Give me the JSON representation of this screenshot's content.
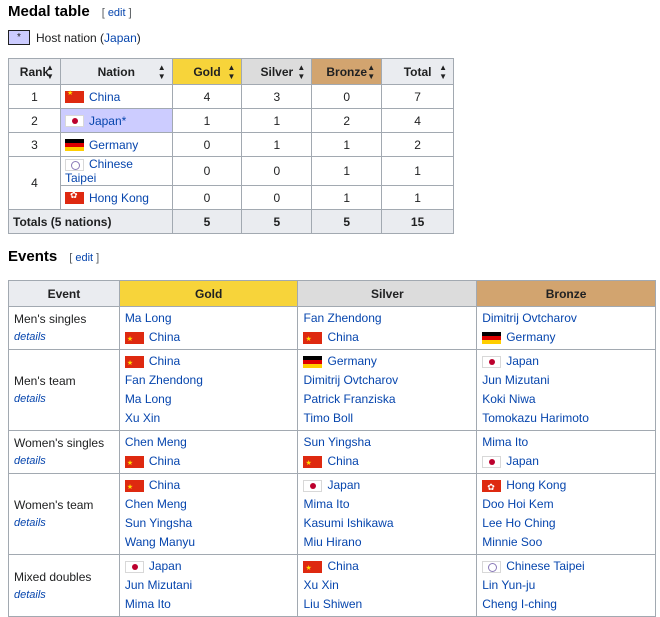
{
  "medal_section": {
    "title": "Medal table",
    "edit_label": "edit",
    "host_marker": "*",
    "host_note_prefix": "Host nation (",
    "host_note_link": "Japan",
    "host_note_suffix": ")"
  },
  "medal_table": {
    "headers": [
      "Rank",
      "Nation",
      "Gold",
      "Silver",
      "Bronze",
      "Total"
    ],
    "rows": [
      {
        "rank": "1",
        "flag": "china-flag-icon",
        "nation": "China",
        "gold": "4",
        "silver": "3",
        "bronze": "0",
        "total": "7"
      },
      {
        "rank": "2",
        "flag": "japan-flag-icon",
        "nation": "Japan*",
        "gold": "1",
        "silver": "1",
        "bronze": "2",
        "total": "4"
      },
      {
        "rank": "3",
        "flag": "germany-flag-icon",
        "nation": "Germany",
        "gold": "0",
        "silver": "1",
        "bronze": "1",
        "total": "2"
      },
      {
        "rank": "4",
        "flag": "chinese-taipei-flag-icon",
        "nation": "Chinese Taipei",
        "gold": "0",
        "silver": "0",
        "bronze": "1",
        "total": "1"
      },
      {
        "rank": "",
        "flag": "hong-kong-flag-icon",
        "nation": "Hong Kong",
        "gold": "0",
        "silver": "0",
        "bronze": "1",
        "total": "1"
      }
    ],
    "totals": {
      "label": "Totals (5 nations)",
      "gold": "5",
      "silver": "5",
      "bronze": "5",
      "total": "15"
    }
  },
  "events_section": {
    "title": "Events",
    "edit_label": "edit"
  },
  "events_table": {
    "headers": [
      "Event",
      "Gold",
      "Silver",
      "Bronze"
    ],
    "details_label": "details",
    "rows": [
      {
        "event": "Men's singles",
        "gold": {
          "flag": "China",
          "players": [
            "Ma Long"
          ],
          "flag_after": true
        },
        "silver": {
          "flag": "China",
          "players": [
            "Fan Zhendong"
          ],
          "flag_after": true
        },
        "bronze": {
          "flag": "Germany",
          "players": [
            "Dimitrij Ovtcharov"
          ],
          "flag_after": true
        }
      },
      {
        "event": "Men's team",
        "gold": {
          "flag": "China",
          "players": [
            "Fan Zhendong",
            "Ma Long",
            "Xu Xin"
          ]
        },
        "silver": {
          "flag": "Germany",
          "players": [
            "Dimitrij Ovtcharov",
            "Patrick Franziska",
            "Timo Boll"
          ]
        },
        "bronze": {
          "flag": "Japan",
          "players": [
            "Jun Mizutani",
            "Koki Niwa",
            "Tomokazu Harimoto"
          ]
        }
      },
      {
        "event": "Women's singles",
        "gold": {
          "flag": "China",
          "players": [
            "Chen Meng"
          ],
          "flag_after": true
        },
        "silver": {
          "flag": "China",
          "players": [
            "Sun Yingsha"
          ],
          "flag_after": true
        },
        "bronze": {
          "flag": "Japan",
          "players": [
            "Mima Ito"
          ],
          "flag_after": true
        }
      },
      {
        "event": "Women's team",
        "gold": {
          "flag": "China",
          "players": [
            "Chen Meng",
            "Sun Yingsha",
            "Wang Manyu"
          ]
        },
        "silver": {
          "flag": "Japan",
          "players": [
            "Mima Ito",
            "Kasumi Ishikawa",
            "Miu Hirano"
          ]
        },
        "bronze": {
          "flag": "Hong Kong",
          "players": [
            "Doo Hoi Kem",
            "Lee Ho Ching",
            "Minnie Soo"
          ]
        }
      },
      {
        "event": "Mixed doubles",
        "gold": {
          "flag": "Japan",
          "players": [
            "Jun Mizutani",
            "Mima Ito"
          ]
        },
        "silver": {
          "flag": "China",
          "players": [
            "Xu Xin",
            "Liu Shiwen"
          ]
        },
        "bronze": {
          "flag": "Chinese Taipei",
          "players": [
            "Lin Yun-ju",
            "Cheng I-ching"
          ]
        }
      }
    ]
  },
  "colors": {
    "gold": "#f7d43a",
    "silver": "#dcdcdc",
    "bronze": "#d2a46f",
    "header": "#eaecf0",
    "host": "#ccccff",
    "link": "#0645ad"
  }
}
